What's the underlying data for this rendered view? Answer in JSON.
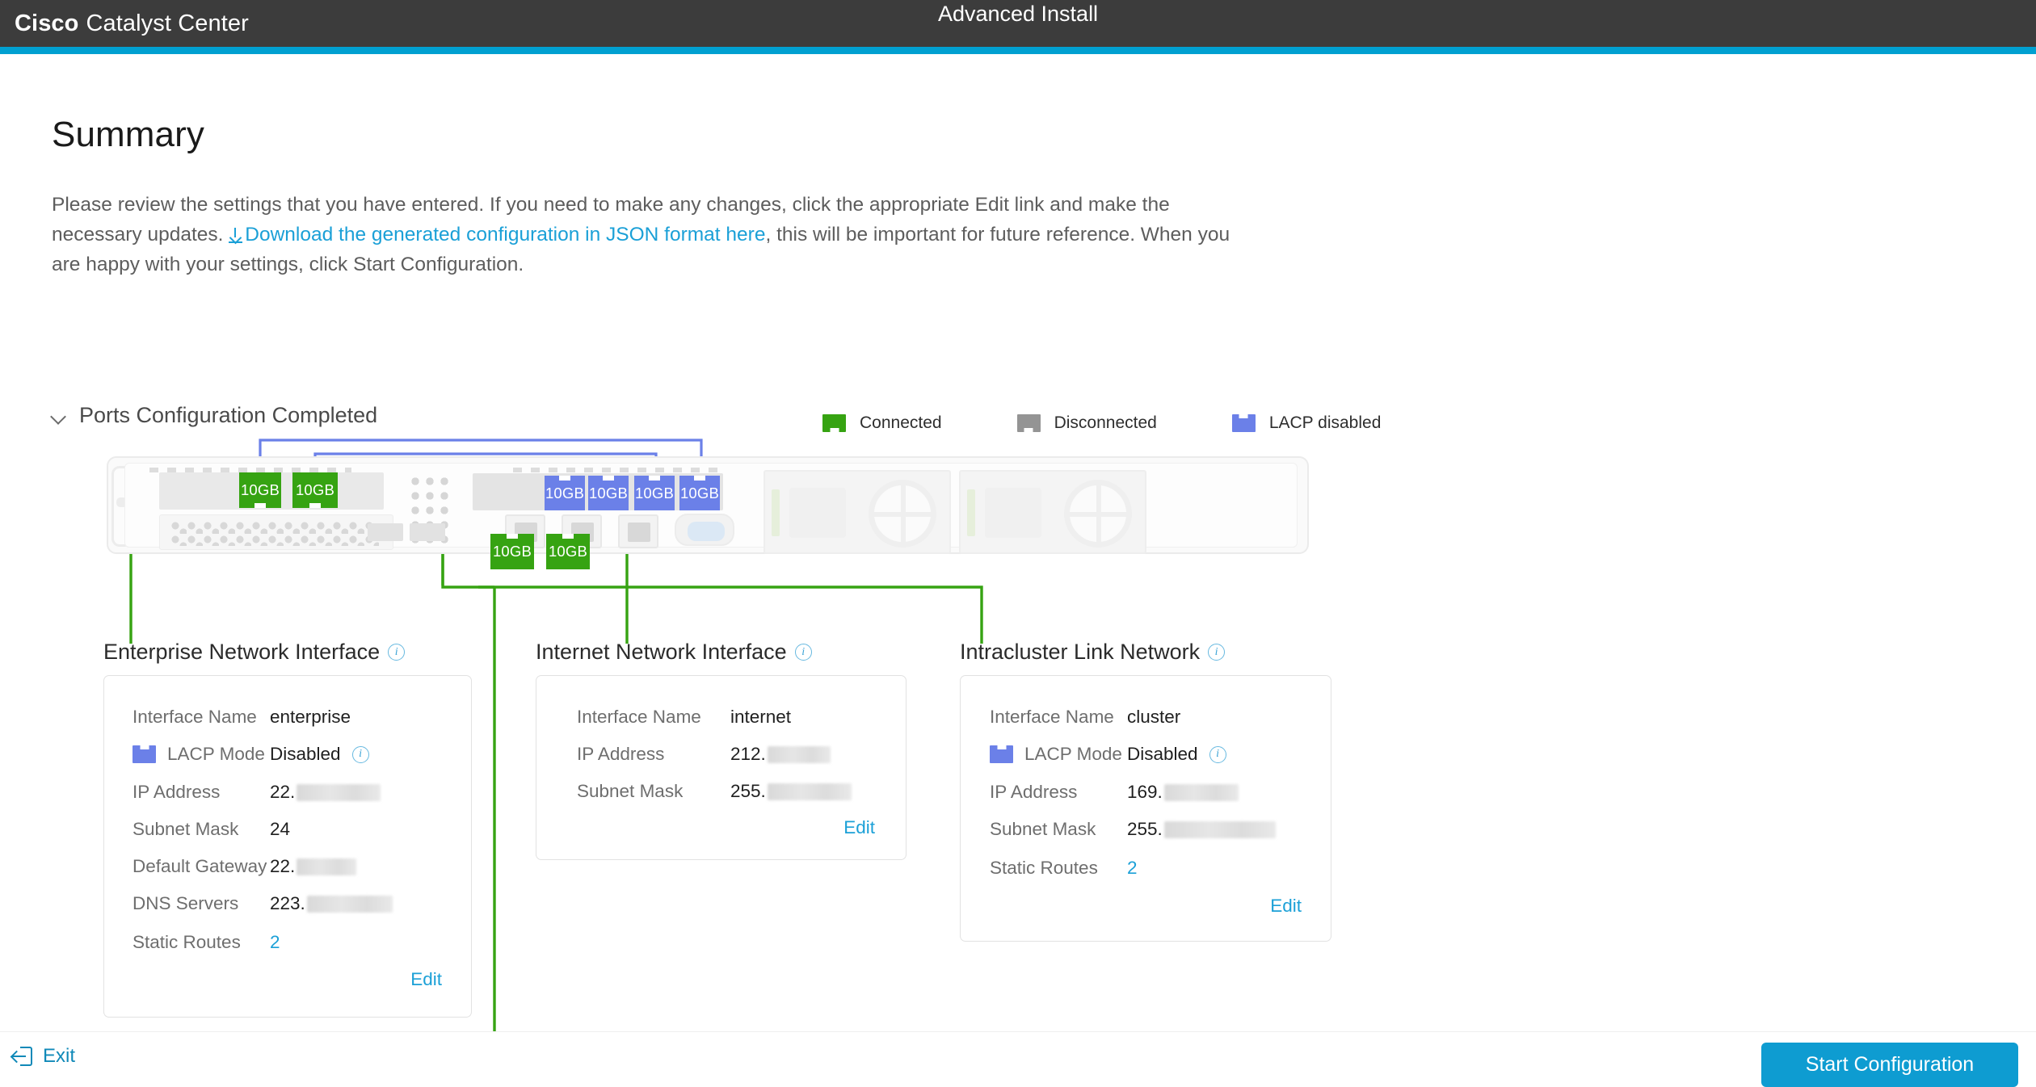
{
  "topbar": {
    "brand_bold": "Cisco",
    "brand_light": "Catalyst Center",
    "title": "Advanced Install",
    "accent_color": "#00a0d1"
  },
  "page": {
    "title": "Summary",
    "intro_part1": "Please review the settings that you have entered. If you need to make any changes, click the appropriate Edit link and make the necessary updates. ",
    "download_link": "Download the generated configuration in JSON format here",
    "intro_part2": ", this will be important for future reference. When you are happy with your settings, click Start Configuration."
  },
  "ports_section": {
    "header": "Ports Configuration Completed",
    "chevron_icon": "chevron-down-icon",
    "legend": [
      {
        "label": "Connected",
        "color": "#36a312",
        "swatch": "green"
      },
      {
        "label": "Disconnected",
        "color": "#949494",
        "swatch": "gray"
      },
      {
        "label": "LACP disabled",
        "color": "#6b80e8",
        "swatch": "blue"
      }
    ],
    "ports": [
      {
        "label": "10GB",
        "state": "connected"
      },
      {
        "label": "10GB",
        "state": "connected"
      },
      {
        "label": "10GB",
        "state": "lacp-disabled"
      },
      {
        "label": "10GB",
        "state": "lacp-disabled"
      },
      {
        "label": "10GB",
        "state": "lacp-disabled"
      },
      {
        "label": "10GB",
        "state": "lacp-disabled"
      },
      {
        "label": "10GB",
        "state": "connected"
      },
      {
        "label": "10GB",
        "state": "connected"
      }
    ]
  },
  "interfaces": [
    {
      "title": "Enterprise Network Interface",
      "rows": [
        {
          "label": "Interface Name",
          "value": "enterprise",
          "redacted": 0,
          "lacp": false,
          "info": false,
          "link": false
        },
        {
          "label": "LACP Mode",
          "value": "Disabled",
          "redacted": 0,
          "lacp": true,
          "info": true,
          "link": false
        },
        {
          "label": "IP Address",
          "value": "22.",
          "redacted": 104,
          "lacp": false,
          "info": false,
          "link": false
        },
        {
          "label": "Subnet Mask",
          "value": "24",
          "redacted": 0,
          "lacp": false,
          "info": false,
          "link": false
        },
        {
          "label": "Default Gateway",
          "value": "22.",
          "redacted": 74,
          "lacp": false,
          "info": false,
          "link": false
        },
        {
          "label": "DNS Servers",
          "value": "223.",
          "redacted": 106,
          "lacp": false,
          "info": false,
          "link": false
        },
        {
          "label": "Static Routes",
          "value": "2",
          "redacted": 0,
          "lacp": false,
          "info": false,
          "link": true
        }
      ],
      "edit_label": "Edit"
    },
    {
      "title": "Internet Network Interface",
      "rows": [
        {
          "label": "Interface Name",
          "value": "internet",
          "redacted": 0,
          "lacp": false,
          "info": false,
          "link": false
        },
        {
          "label": "IP Address",
          "value": "212.",
          "redacted": 78,
          "lacp": false,
          "info": false,
          "link": false
        },
        {
          "label": "Subnet Mask",
          "value": "255.",
          "redacted": 104,
          "lacp": false,
          "info": false,
          "link": false
        }
      ],
      "edit_label": "Edit"
    },
    {
      "title": "Intracluster Link Network",
      "rows": [
        {
          "label": "Interface Name",
          "value": "cluster",
          "redacted": 0,
          "lacp": false,
          "info": false,
          "link": false
        },
        {
          "label": "LACP Mode",
          "value": "Disabled",
          "redacted": 0,
          "lacp": true,
          "info": true,
          "link": false
        },
        {
          "label": "IP Address",
          "value": "169.",
          "redacted": 92,
          "lacp": false,
          "info": false,
          "link": false
        },
        {
          "label": "Subnet Mask",
          "value": "255.",
          "redacted": 138,
          "lacp": false,
          "info": false,
          "link": false
        },
        {
          "label": "Static Routes",
          "value": "2",
          "redacted": 0,
          "lacp": false,
          "info": false,
          "link": true
        }
      ],
      "edit_label": "Edit"
    }
  ],
  "footer": {
    "exit_label": "Exit",
    "exit_icon": "exit-arrow-icon",
    "start_label": "Start Configuration",
    "start_color": "#0e9cd1"
  }
}
